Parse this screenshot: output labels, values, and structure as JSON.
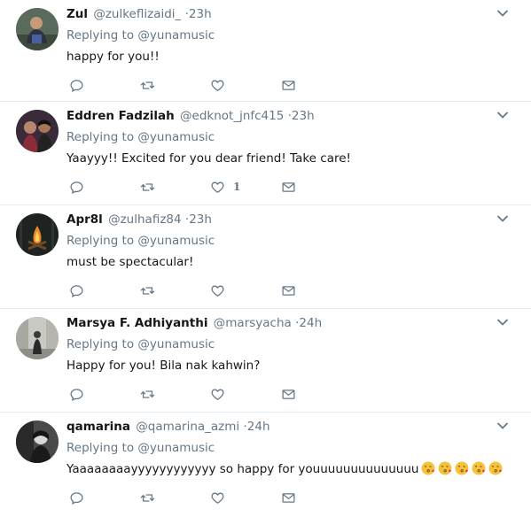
{
  "colors": {
    "secondary_text": "#657786",
    "primary_text": "#14171a",
    "divider": "#e6ecf0",
    "icon": "#657786"
  },
  "tweets": [
    {
      "fullname": "Zul",
      "username": "@zulkeflizaidi_",
      "separator": "·",
      "timestamp": "23h",
      "replying_prefix": "Replying to",
      "replying_handle": "@yunamusic",
      "text": "happy for you!!",
      "like_count": "",
      "avatar_icon": "person-photo"
    },
    {
      "fullname": "Eddren Fadzilah",
      "username": "@edknot_jnfc415",
      "separator": "·",
      "timestamp": "23h",
      "replying_prefix": "Replying to",
      "replying_handle": "@yunamusic",
      "text": "Yaayyy!! Excited for you dear friend! Take care!",
      "like_count": "1",
      "avatar_icon": "couple-photo"
    },
    {
      "fullname": "Apr8l",
      "username": "@zulhafiz84",
      "separator": "·",
      "timestamp": "23h",
      "replying_prefix": "Replying to",
      "replying_handle": "@yunamusic",
      "text": "must be spectacular!",
      "like_count": "",
      "avatar_icon": "campfire-photo"
    },
    {
      "fullname": "Marsya F. Adhiyanthi",
      "username": "@marsyacha",
      "separator": "·",
      "timestamp": "24h",
      "replying_prefix": "Replying to",
      "replying_handle": "@yunamusic",
      "text": "Happy for you! Bila nak kahwin?",
      "like_count": "",
      "avatar_icon": "street-photo"
    },
    {
      "fullname": "qamarina",
      "username": "@qamarina_azmi",
      "separator": "·",
      "timestamp": "24h",
      "replying_prefix": "Replying to",
      "replying_handle": "@yunamusic",
      "text": "Yaaaaaaaayyyyyyyyyyyy so happy for youuuuuuuuuuuuuu",
      "emojis": [
        "face-blowing-kiss-emoji",
        "face-blowing-kiss-emoji",
        "face-blowing-kiss-emoji",
        "face-blowing-kiss-emoji",
        "face-blowing-kiss-emoji"
      ],
      "like_count": "",
      "avatar_icon": "portrait-photo"
    }
  ]
}
